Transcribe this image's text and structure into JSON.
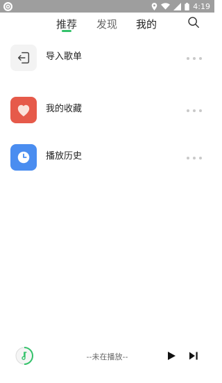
{
  "status_bar": {
    "time": "4:19"
  },
  "tabs": [
    {
      "label": "推荐",
      "active": true
    },
    {
      "label": "发现",
      "active": false
    },
    {
      "label": "我的",
      "active": false
    }
  ],
  "colors": {
    "accent": "#35c26b",
    "import_icon_bg": "#f3f3f3",
    "favorites_icon_bg": "#e65a4a",
    "history_icon_bg": "#4a8df0",
    "status_bar_bg": "#9e9e9e"
  },
  "list_items": [
    {
      "label": "导入歌单",
      "icon": "import-icon"
    },
    {
      "label": "我的收藏",
      "icon": "heart-icon"
    },
    {
      "label": "播放历史",
      "icon": "clock-icon"
    }
  ],
  "player": {
    "status": "--未在播放--"
  }
}
